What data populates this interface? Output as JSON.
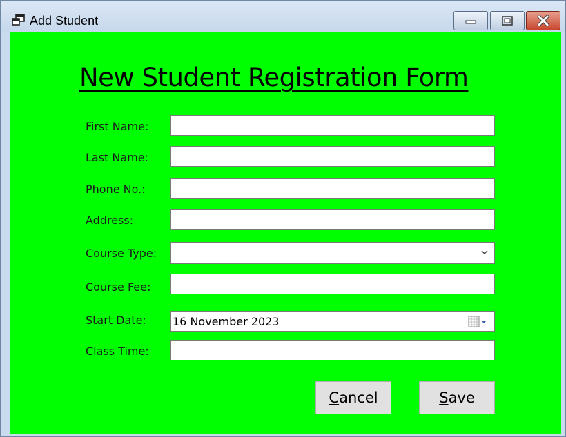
{
  "window": {
    "title": "Add Student",
    "app_icon": "windows-app-icon",
    "buttons": [
      "minimize-icon",
      "maximize-icon",
      "close-icon"
    ],
    "close_color": "#c8462f",
    "background_color": "#00ff00"
  },
  "form": {
    "heading": "New Student Registration Form",
    "labels": {
      "first_name": "First Name:",
      "last_name": "Last Name:",
      "phone": "Phone No.:",
      "address": "Address:",
      "course_type": "Course Type:",
      "course_fee": "Course Fee:",
      "start_date": "Start Date:",
      "class_time": "Class Time:"
    },
    "values": {
      "first_name": "",
      "last_name": "",
      "phone": "",
      "address": "",
      "course_type": "",
      "course_fee": "",
      "start_date": "16 November 2023",
      "class_time": ""
    }
  },
  "buttons": {
    "cancel_first": "C",
    "cancel_rest": "ancel",
    "save_first": "S",
    "save_rest": "ave"
  }
}
